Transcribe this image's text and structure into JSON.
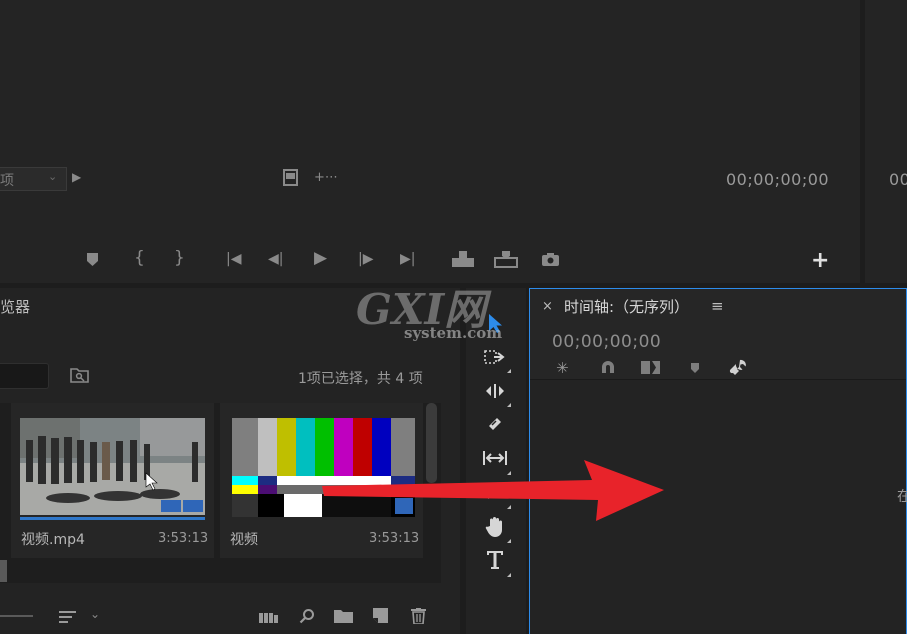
{
  "source_monitor": {
    "page_select": "项",
    "timecode": "00;00;00;00"
  },
  "program_monitor": {
    "timecode_partial": "00"
  },
  "project_panel": {
    "title_partial": "览器",
    "selection_status": "1项已选择，共 4 项",
    "items": [
      {
        "name": "视频.mp4",
        "duration": "3:53:13"
      },
      {
        "name": "视频",
        "duration": "3:53:13"
      }
    ]
  },
  "timeline": {
    "close": "×",
    "title": "时间轴:（无序列）",
    "menu": "≡",
    "timecode": "00;00;00;00",
    "hint_partial": "在"
  },
  "watermark": {
    "logo": "GXI网",
    "domain": "system.com"
  },
  "colors": {
    "accent_blue": "#2d8ceb",
    "arrow_red": "#e8232a",
    "panel_bg": "#232323"
  }
}
